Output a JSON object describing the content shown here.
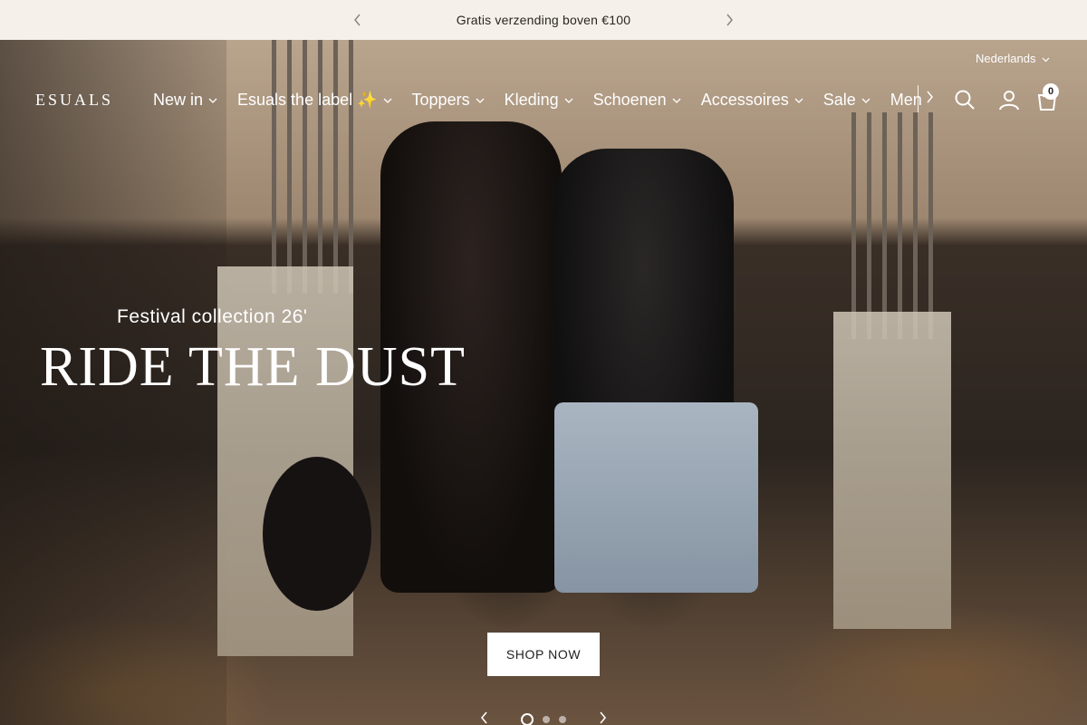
{
  "announcement": {
    "text": "Gratis verzending boven €100",
    "prev_icon": "chevron-left-icon",
    "next_icon": "chevron-right-icon"
  },
  "header": {
    "language": "Nederlands",
    "logo": "ESUALS",
    "nav": [
      {
        "label": "New in"
      },
      {
        "label": "Esuals the label ✨"
      },
      {
        "label": "Toppers"
      },
      {
        "label": "Kleding"
      },
      {
        "label": "Schoenen"
      },
      {
        "label": "Accessoires"
      },
      {
        "label": "Sale"
      },
      {
        "label": "Men"
      }
    ],
    "icons": [
      "search-icon",
      "account-icon",
      "cart-icon"
    ],
    "cart_count": "0"
  },
  "hero": {
    "subtitle": "Festival collection 26'",
    "headline": "RIDE THE DUST",
    "cta": "SHOP NOW",
    "slides_total": 3,
    "active_slide": 1
  }
}
